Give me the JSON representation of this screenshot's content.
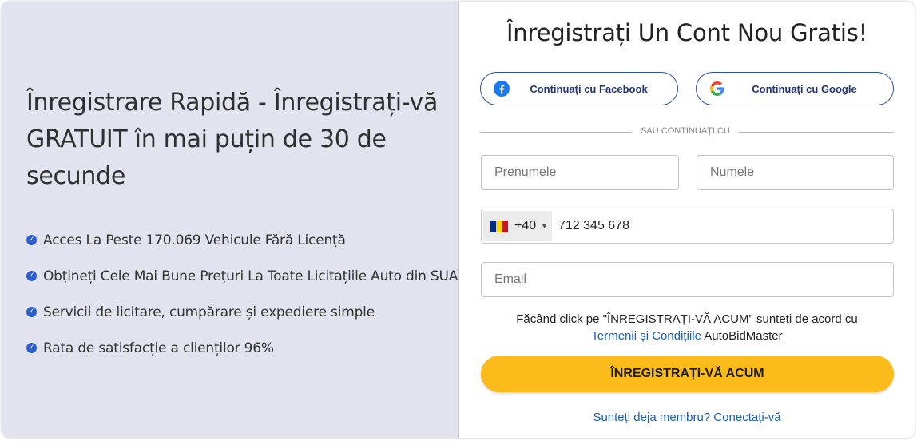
{
  "left": {
    "title": "Înregistrare Rapidă - Înregistrați-vă GRATUIT în mai puțin de 30 de secunde",
    "benefits": [
      "Acces La Peste 170.069 Vehicule Fără Licență",
      "Obțineți Cele Mai Bune Prețuri La Toate Licitațiile Auto din SUA",
      "Servicii de licitare, cumpărare și expediere simple",
      "Rata de satisfacție a clienților 96%"
    ]
  },
  "form": {
    "title": "Înregistrați Un Cont Nou Gratis!",
    "facebook_label": "Continuați cu Facebook",
    "google_label": "Continuați cu Google",
    "separator": "SAU CONTINUAȚI CU",
    "first_name_placeholder": "Prenumele",
    "last_name_placeholder": "Numele",
    "phone": {
      "country_code": "+40",
      "value": "712 345 678",
      "flag_icon": "romania-flag-icon"
    },
    "email_placeholder": "Email",
    "terms_prefix": "Făcând click pe \"ÎNREGISTRAȚI-VĂ ACUM\" sunteți de acord cu",
    "terms_link": "Termenii și Condițiile",
    "terms_suffix": " AutoBidMaster",
    "submit_label": "ÎNREGISTRAȚI-VĂ ACUM",
    "login_link": "Sunteți deja membru? Conectați-vă"
  },
  "colors": {
    "left_panel_bg": "#e2e3ee",
    "accent_blue": "#2c5fd0",
    "cta_yellow": "#fbbc1b",
    "link_blue": "#1a5fb4"
  }
}
